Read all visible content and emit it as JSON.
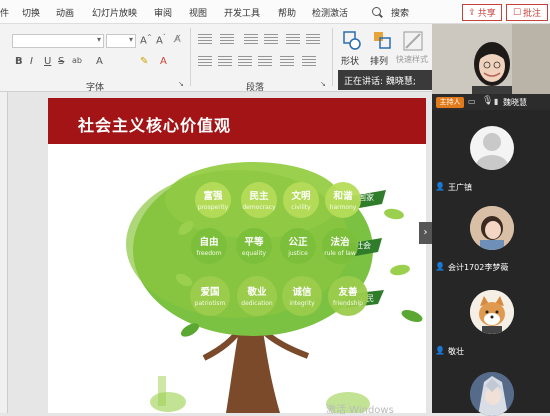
{
  "menu": {
    "items": [
      "切换",
      "动画",
      "幻灯片放映",
      "审阅",
      "视图",
      "开发工具",
      "帮助",
      "检测激活"
    ],
    "search_label": "搜索",
    "share_label": "共享",
    "comment_label": "批注"
  },
  "ribbon": {
    "groups": {
      "font": "字体",
      "paragraph": "段落"
    },
    "format_buttons": [
      "B",
      "I",
      "U",
      "S",
      "ab",
      "A"
    ],
    "font_size_buttons": [
      "A^",
      "A^"
    ],
    "arrange_buttons": [
      {
        "label": "形状",
        "icon": "shapes-icon"
      },
      {
        "label": "排列",
        "icon": "arrange-icon"
      },
      {
        "label": "快速样式",
        "icon": "quick-styles-icon"
      }
    ],
    "speaking_tip": "正在讲话: 魏晓慧;"
  },
  "slide": {
    "title": "社会主义核心价值观",
    "tree_values": [
      {
        "cn": "富强",
        "en": "prosperity"
      },
      {
        "cn": "民主",
        "en": "democracy"
      },
      {
        "cn": "文明",
        "en": "civility"
      },
      {
        "cn": "和谐",
        "en": "harmony"
      },
      {
        "cn": "自由",
        "en": "freedom"
      },
      {
        "cn": "平等",
        "en": "equality"
      },
      {
        "cn": "公正",
        "en": "justice"
      },
      {
        "cn": "法治",
        "en": "rule of law"
      },
      {
        "cn": "爱国",
        "en": "patriotism"
      },
      {
        "cn": "敬业",
        "en": "dedication"
      },
      {
        "cn": "诚信",
        "en": "integrity"
      },
      {
        "cn": "友善",
        "en": "friendship"
      }
    ],
    "levels": [
      "国家",
      "社会",
      "公民"
    ]
  },
  "watermark": "激活 Windows",
  "video": {
    "host_badge": "主持人",
    "speaker_name": "魏晓慧",
    "participants": [
      "王广镇",
      "会计1702李梦薇",
      "敬壮"
    ]
  }
}
